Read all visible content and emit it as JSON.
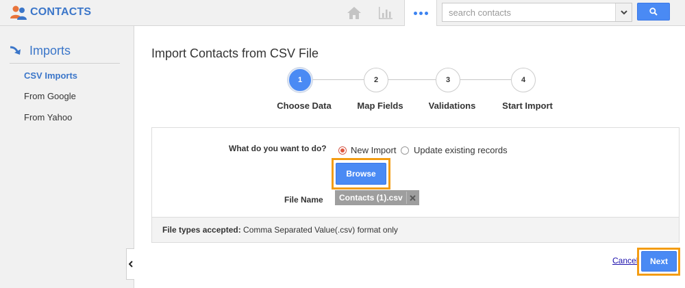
{
  "app": {
    "title": "CONTACTS",
    "brand_color": "#3b76c9",
    "logo_icon": "contacts-people-icon"
  },
  "header": {
    "nav": [
      {
        "icon": "home-icon"
      },
      {
        "icon": "bar-chart-icon"
      },
      {
        "icon": "more-dots-icon",
        "active": true
      }
    ],
    "search": {
      "placeholder": "search contacts",
      "value": "",
      "dropdown_icon": "chevron-down-icon",
      "button_icon": "search-icon"
    }
  },
  "sidebar": {
    "section": "Imports",
    "section_icon": "arrow-curve-icon",
    "items": [
      {
        "label": "CSV Imports",
        "active": true
      },
      {
        "label": "From Google",
        "active": false
      },
      {
        "label": "From Yahoo",
        "active": false
      }
    ],
    "collapse_icon": "chevron-left-icon"
  },
  "main": {
    "title": "Import Contacts from CSV File",
    "steps": [
      {
        "number": "1",
        "label": "Choose Data",
        "active": true
      },
      {
        "number": "2",
        "label": "Map Fields",
        "active": false
      },
      {
        "number": "3",
        "label": "Validations",
        "active": false
      },
      {
        "number": "4",
        "label": "Start Import",
        "active": false
      }
    ],
    "form": {
      "question": "What do you want to do?",
      "options": [
        {
          "label": "New Import",
          "checked": true
        },
        {
          "label": "Update existing records",
          "checked": false
        }
      ],
      "browse_label": "Browse",
      "file_label": "File Name",
      "file_name": "Contacts (1).csv",
      "file_remove_icon": "close-icon",
      "footer_bold": "File types accepted:",
      "footer_text": " Comma Separated Value(.csv) format only"
    },
    "actions": {
      "cancel_label": "Cancel",
      "next_label": "Next"
    }
  },
  "colors": {
    "primary_button": "#4a8af4",
    "highlight_border": "#f39c12",
    "radio_checked": "#e0573f",
    "link": "#1a0dab"
  }
}
